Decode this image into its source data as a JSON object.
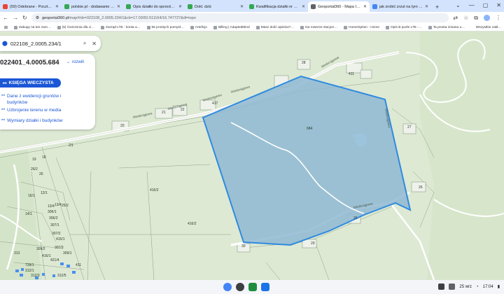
{
  "tabs": [
    {
      "label": "(59) Odebrane - Poczta - …",
      "color": "#ea4335",
      "active": false
    },
    {
      "label": "polskie.pl - dodawanie ogł…",
      "color": "#34a853",
      "active": false
    },
    {
      "label": "Opis działki do sprzedaży",
      "color": "#34a853",
      "active": false
    },
    {
      "label": "Dokl. dziś",
      "color": "#34a853",
      "active": false
    },
    {
      "label": "Kwalifikacja działki nr 234/…",
      "color": "#34a853",
      "active": false
    },
    {
      "label": "Geoportal360 - Mapa Interak…",
      "color": "#5f6368",
      "active": true
    },
    {
      "label": "jak zrobić zrzut na tym komp…",
      "color": "#4285f4",
      "active": false
    }
  ],
  "new_tab": "+",
  "window_controls": [
    "⌄",
    "—",
    "▢",
    "✕"
  ],
  "address": {
    "domain": "geoportal360.pl",
    "path": "/map/#dx=022108_2.0005.234/1&cb=17.03/50.511164/16.747727&dl=topo"
  },
  "bookmarks": [
    "Zakupy na ten zam…",
    "(5) Ćwiczenia dla ci…",
    "Zarząd LTE - konta a…",
    "55 prostych pomysł…",
    "Arteficjo",
    "Billing | AdaptedMind",
    "Masz dość wpisów?…",
    "Na rowerze stacjon…",
    "HomeOption - Home",
    "Opis B puzle LTE -…",
    "Ta prosta zmiana u…"
  ],
  "all_bookmarks": "Wszystkie zakł…",
  "search": {
    "query": "022108_2.0005.234/1"
  },
  "panel": {
    "parcel_id": "022401_4.0005.684",
    "expand_label": "rozwiń",
    "kw_button": "KSIĘGA WIECZYSTA",
    "links": [
      "Dane z ewidencji gruntów i budynków",
      "Uzbrojenie terenu w media",
      "Wymiary działki i budynków"
    ]
  },
  "map_labels": {
    "parcels": [
      "684",
      "416/2",
      "416/2",
      "25",
      "26",
      "27",
      "28",
      "29",
      "30",
      "417",
      "22",
      "21",
      "20",
      "19",
      "18",
      "26/2",
      "26",
      "12/1",
      "16/1",
      "13/4",
      "14/1",
      "13/4",
      "306/1",
      "306/2",
      "307/1",
      "307/2",
      "415/1",
      "307/3",
      "309/1",
      "309/2",
      "416/1",
      "421/4",
      "411",
      "728/1",
      "312/1",
      "312/3",
      "312/5",
      "313",
      "2/1",
      "25/2",
      "411"
    ],
    "roads": [
      "Wodociągowa",
      "Wodociągowa",
      "Wodociągowa",
      "Wodociągowa",
      "Wodociągowa",
      "Wodociągowa",
      "Wodociągowa"
    ]
  },
  "taskbar": {
    "date": "25 wrz",
    "time": "17:04",
    "apps": [
      "#4285f4",
      "#3c4043",
      "#1e8e3e",
      "#1a73e8"
    ]
  },
  "colors": {
    "parcel_fill": "#8fb9d2",
    "parcel_stroke": "#2f8ae0",
    "link": "#1a56d6"
  }
}
